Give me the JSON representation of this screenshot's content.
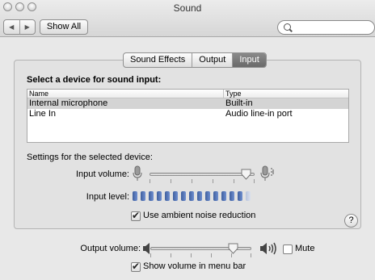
{
  "window": {
    "title": "Sound"
  },
  "toolbar": {
    "back_icon": "back-arrow-icon",
    "forward_icon": "forward-arrow-icon",
    "back_glyph": "◀",
    "forward_glyph": "▶",
    "show_all_label": "Show All",
    "search": {
      "value": "",
      "placeholder": ""
    }
  },
  "tabs": [
    {
      "label": "Sound Effects",
      "active": false
    },
    {
      "label": "Output",
      "active": false
    },
    {
      "label": "Input",
      "active": true
    }
  ],
  "input_panel": {
    "heading": "Select a device for sound input:",
    "columns": [
      "Name",
      "Type"
    ],
    "devices": [
      {
        "name": "Internal microphone",
        "type": "Built-in",
        "selected": true
      },
      {
        "name": "Line In",
        "type": "Audio line-in port",
        "selected": false
      }
    ],
    "settings_heading": "Settings for the selected device:",
    "input_volume_label": "Input volume:",
    "input_volume_fraction": 0.92,
    "input_level_label": "Input level:",
    "input_level_segments_total": 15,
    "input_level_segments_lit": 14,
    "ambient_noise_label": "Use ambient noise reduction",
    "ambient_noise_checked": true
  },
  "help_glyph": "?",
  "output": {
    "volume_label": "Output volume:",
    "volume_fraction": 0.82,
    "mute_label": "Mute",
    "mute_checked": false,
    "show_in_menu_label": "Show volume in menu bar",
    "show_in_menu_checked": true
  },
  "colors": {
    "meter_lit": "#4f6fb0",
    "meter_dim": "#c6d0e4",
    "tab_active": "#7a7a7a"
  }
}
